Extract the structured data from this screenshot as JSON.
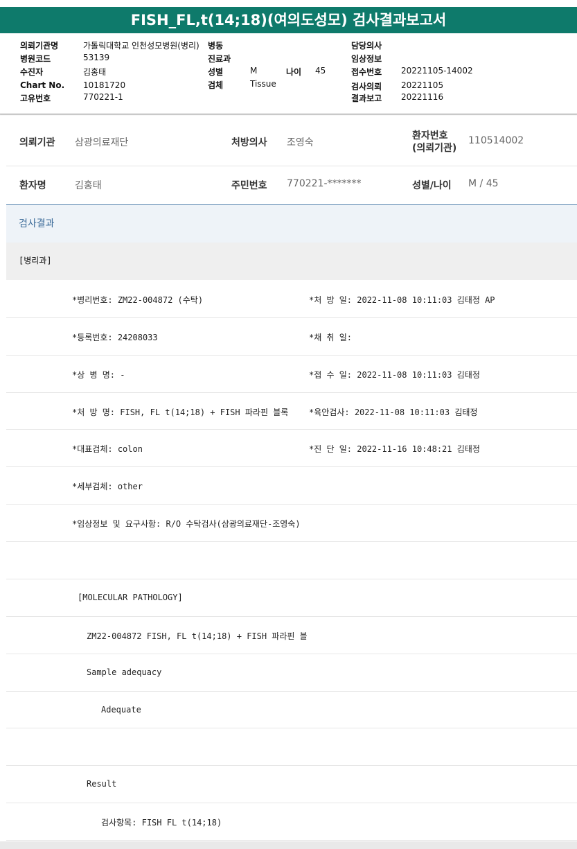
{
  "report": {
    "title": "FISH_FL,t(14;18)(여의도성모) 검사결과보고서"
  },
  "header": {
    "labels": {
      "req_inst": "의뢰기관명",
      "hosp_code": "병원코드",
      "collector": "수진자",
      "chart_no": "Chart No.",
      "unique_no": "고유번호",
      "ward": "병동",
      "dept": "진료과",
      "sex": "성별",
      "age": "나이",
      "specimen": "검체",
      "doctor": "담당의사",
      "clinical_info": "임상정보",
      "receipt_no": "접수번호",
      "test_request": "검사의뢰",
      "result_report": "결과보고"
    },
    "values": {
      "req_inst": "가톨릭대학교 인천성모병원(병리)",
      "hosp_code": "53139",
      "collector": "김홍태",
      "chart_no": "10181720",
      "unique_no": "770221-1",
      "sex": "M",
      "age": "45",
      "specimen": "Tissue",
      "receipt_no": "20221105-14002",
      "test_request": "20221105",
      "result_report": "20221116"
    }
  },
  "patient": {
    "labels": {
      "req_inst": "의뢰기관",
      "prescriber": "처방의사",
      "patient_no_line1": "환자번호",
      "patient_no_line2": "(의뢰기관)",
      "patient_name": "환자명",
      "resident_no": "주민번호",
      "sex_age": "성별/나이"
    },
    "values": {
      "req_inst": "삼광의료재단",
      "prescriber": "조영숙",
      "patient_no": "110514002",
      "patient_name": "김홍태",
      "resident_no": "770221-*******",
      "sex_age": "M / 45"
    }
  },
  "results": {
    "section_title": "검사결과",
    "dept": "[병리과]",
    "rows": [
      {
        "left": "*병리번호: ZM22-004872 (수탁)",
        "right": "*처 방 일: 2022-11-08 10:11:03  김태정 AP"
      },
      {
        "left": "*등록번호: 24208033",
        "right": "*채 취 일:"
      },
      {
        "left": "*상 병 명: -",
        "right": "*접 수 일: 2022-11-08 10:11:03  김태정"
      },
      {
        "left": "*처 방 명: FISH, FL t(14;18) + FISH 파라핀 블록",
        "right": "*육안검사: 2022-11-08 10:11:03  김태정"
      },
      {
        "left": "*대표검체: colon",
        "right": "*진 단 일: 2022-11-16 10:48:21  김태정"
      },
      {
        "left": "*세부검체: other",
        "right": ""
      },
      {
        "left": "*임상정보 및 요구사항: R/O 수탁검사(삼광의료재단-조영숙)",
        "right": ""
      }
    ],
    "molecular_header": "[MOLECULAR PATHOLOGY]",
    "case_line": "ZM22-004872     FISH, FL t(14;18) + FISH 파라핀 블",
    "sample_adequacy_label": "Sample adequacy",
    "sample_adequacy_value": "Adequate",
    "result_label": "Result",
    "test_item": "검사항목: FISH FL t(14;18)"
  }
}
